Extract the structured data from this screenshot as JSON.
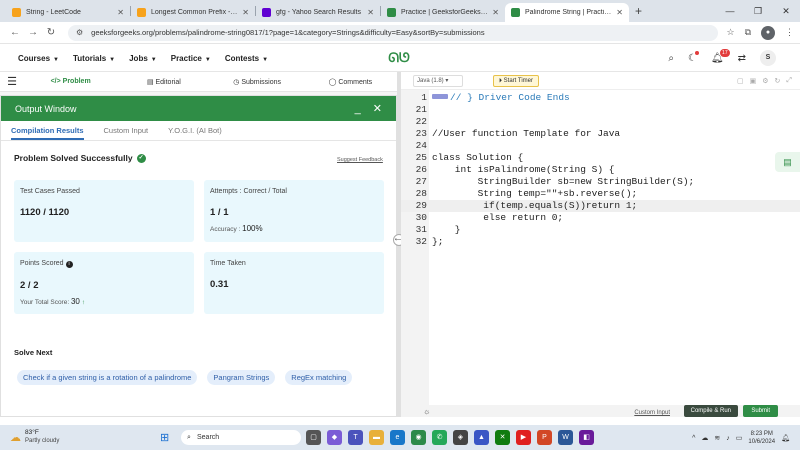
{
  "browser": {
    "tabs": [
      {
        "title": "String - LeetCode",
        "color": "#f7a21b",
        "active": false
      },
      {
        "title": "Longest Common Prefix - LeetC",
        "color": "#f7a21b",
        "active": false
      },
      {
        "title": "gfg - Yahoo Search Results",
        "color": "#6001d2",
        "active": false
      },
      {
        "title": "Practice | GeeksforGeeks | A co",
        "color": "#2f8d46",
        "active": false
      },
      {
        "title": "Palindrome String | Practice | G",
        "color": "#2f8d46",
        "active": true
      }
    ],
    "url": "geeksforgeeks.org/problems/palindrome-string0817/1?page=1&category=Strings&difficulty=Easy&sortBy=submissions"
  },
  "header": {
    "menu": [
      "Courses",
      "Tutorials",
      "Jobs",
      "Practice",
      "Contests"
    ],
    "notif_count": "17",
    "avatar": "S"
  },
  "subtabs": [
    "Problem",
    "Editorial",
    "Submissions",
    "Comments"
  ],
  "output": {
    "title": "Output Window",
    "tabs": [
      "Compilation Results",
      "Custom Input",
      "Y.O.G.I. (AI Bot)"
    ],
    "status": "Problem Solved Successfully",
    "feedback": "Suggest Feedback",
    "cards": {
      "tests_label": "Test Cases Passed",
      "tests_value": "1120 / 1120",
      "attempts_label": "Attempts : Correct / Total",
      "attempts_value": "1 / 1",
      "accuracy_label": "Accuracy :",
      "accuracy_value": "100%",
      "points_label": "Points Scored",
      "points_value": "2 / 2",
      "total_label": "Your Total Score:",
      "total_value": "30",
      "time_label": "Time Taken",
      "time_value": "0.31"
    },
    "solve_next": "Solve Next",
    "suggestions": [
      "Check if a given string is a rotation of a palindrome",
      "Pangram Strings",
      "RegEx matching"
    ]
  },
  "editor": {
    "language": "Java (1.8)",
    "timer": "Start Timer",
    "lines": [
      {
        "n": "1",
        "t": "// } Driver Code Ends"
      },
      {
        "n": "21",
        "t": ""
      },
      {
        "n": "22",
        "t": ""
      },
      {
        "n": "23",
        "t": "//User function Template for Java"
      },
      {
        "n": "24",
        "t": ""
      },
      {
        "n": "25",
        "t": "class Solution {"
      },
      {
        "n": "26",
        "t": "    int isPalindrome(String S) {"
      },
      {
        "n": "27",
        "t": "        StringBuilder sb=new StringBuilder(S);"
      },
      {
        "n": "28",
        "t": "        String temp=\"\"+sb.reverse();"
      },
      {
        "n": "29",
        "t": "         if(temp.equals(S))return 1;"
      },
      {
        "n": "30",
        "t": "         else return 0;"
      },
      {
        "n": "31",
        "t": "    }"
      },
      {
        "n": "32",
        "t": "};"
      }
    ],
    "custom_input": "Custom Input",
    "compile": "Compile & Run",
    "submit": "Submit"
  },
  "taskbar": {
    "temp": "83°F",
    "weather": "Partly cloudy",
    "search": "Search",
    "time": "8:23 PM",
    "date": "10/6/2024"
  }
}
